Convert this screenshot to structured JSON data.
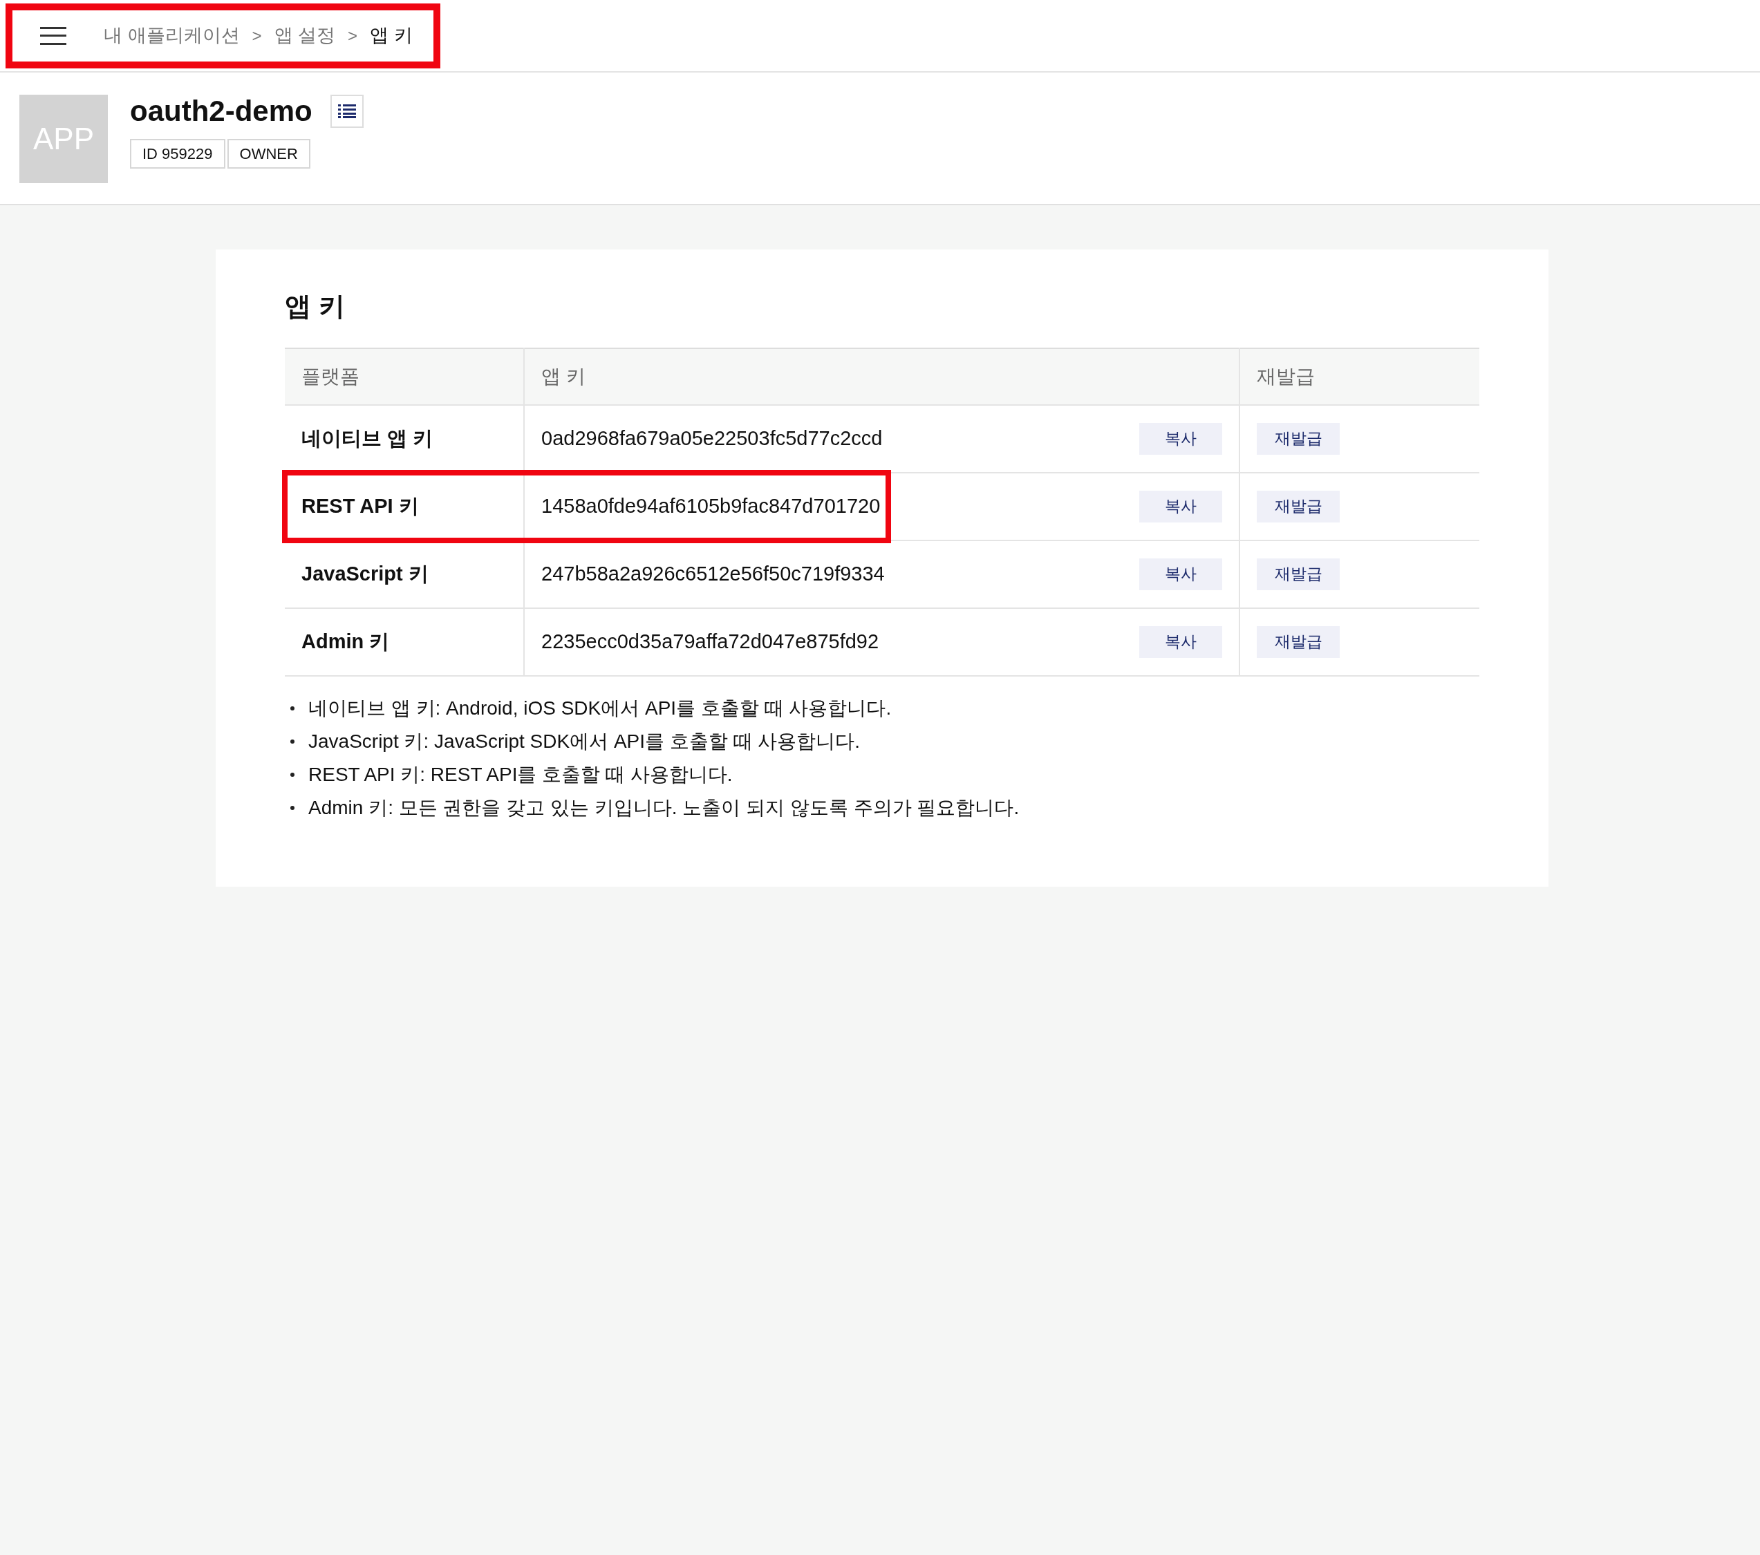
{
  "breadcrumb": {
    "highlighted": true,
    "items": [
      {
        "label": "내 애플리케이션",
        "current": false
      },
      {
        "label": "앱 설정",
        "current": false
      },
      {
        "label": "앱 키",
        "current": true
      }
    ],
    "separator": ">"
  },
  "app": {
    "icon_text": "APP",
    "name": "oauth2-demo",
    "tags": [
      "ID 959229",
      "OWNER"
    ]
  },
  "panel": {
    "title": "앱 키",
    "table": {
      "columns": [
        "플랫폼",
        "앱 키",
        "재발급"
      ],
      "rows": [
        {
          "platform": "네이티브 앱 키",
          "key": "0ad2968fa679a05e22503fc5d77c2ccd",
          "copy": "복사",
          "reissue": "재발급",
          "highlighted": false
        },
        {
          "platform": "REST API 키",
          "key": "1458a0fde94af6105b9fac847d701720",
          "copy": "복사",
          "reissue": "재발급",
          "highlighted": true
        },
        {
          "platform": "JavaScript 키",
          "key": "247b58a2a926c6512e56f50c719f9334",
          "copy": "복사",
          "reissue": "재발급",
          "highlighted": false
        },
        {
          "platform": "Admin 키",
          "key": "2235ecc0d35a79affa72d047e875fd92",
          "copy": "복사",
          "reissue": "재발급",
          "highlighted": false
        }
      ]
    },
    "notes": [
      "네이티브 앱 키: Android, iOS SDK에서 API를 호출할 때 사용합니다.",
      "JavaScript 키: JavaScript SDK에서 API를 호출할 때 사용합니다.",
      "REST API 키: REST API를 호출할 때 사용합니다.",
      "Admin 키: 모든 권한을 갖고 있는 키입니다. 노출이 되지 않도록 주의가 필요합니다."
    ]
  }
}
